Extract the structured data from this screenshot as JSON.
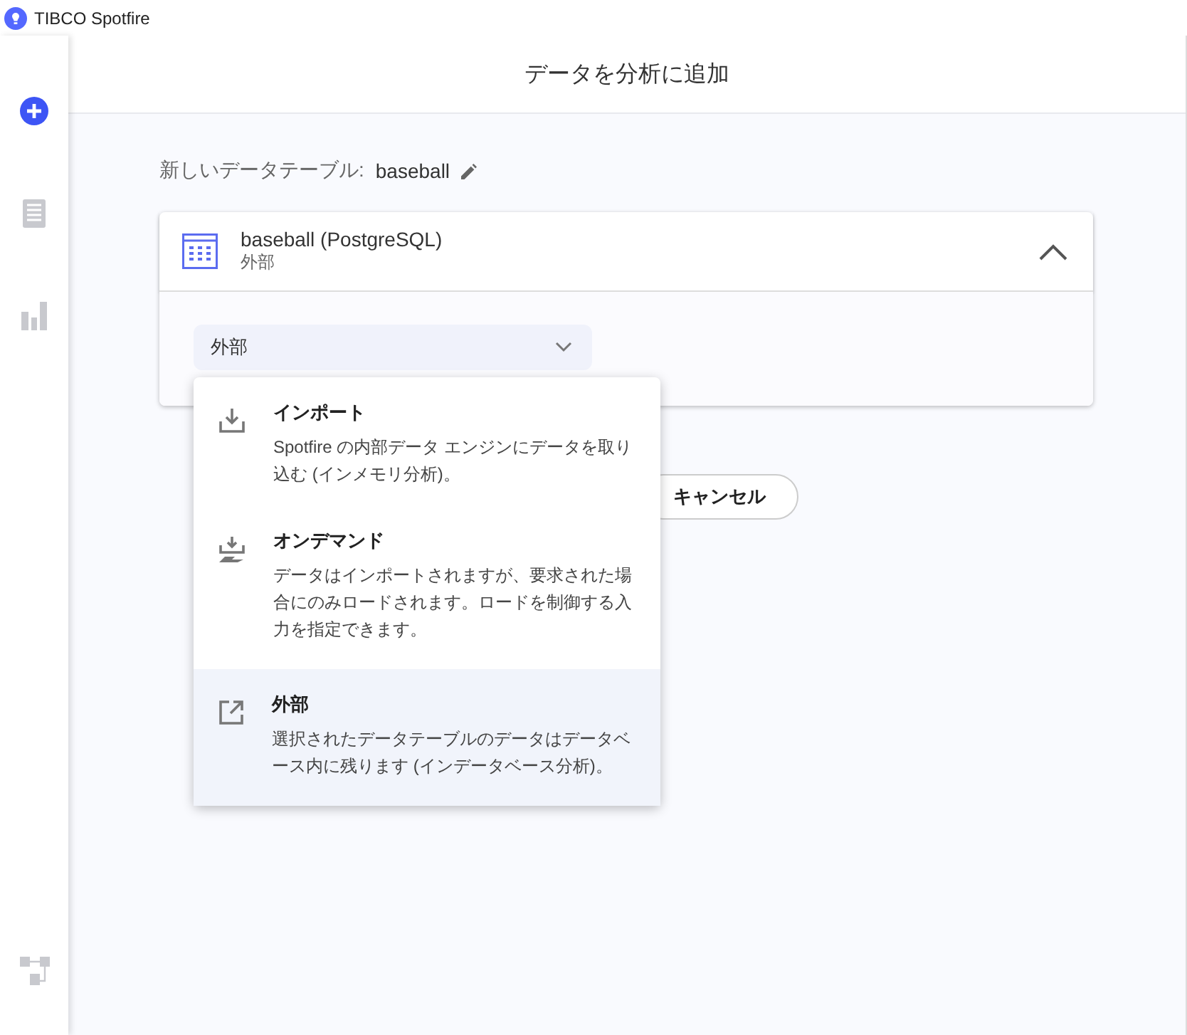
{
  "window": {
    "title": "TIBCO Spotfire"
  },
  "header": {
    "title": "データを分析に追加"
  },
  "table_name": {
    "label": "新しいデータテーブル:",
    "value": "baseball"
  },
  "source_card": {
    "title": "baseball (PostgreSQL)",
    "subtitle": "外部",
    "expanded": true
  },
  "load_method": {
    "value": "外部",
    "expanded": true,
    "options": [
      {
        "kind": "import",
        "title": "インポート",
        "description": "Spotfire の内部データ エンジンにデータを取り込む (インメモリ分析)。",
        "selected": false
      },
      {
        "kind": "ondemand",
        "title": "オンデマンド",
        "description": "データはインポートされますが、要求された場合にのみロードされます。ロードを制御する入力を指定できます。",
        "selected": false
      },
      {
        "kind": "external",
        "title": "外部",
        "description": "選択されたデータテーブルのデータはデータベース内に残ります (インデータベース分析)。",
        "selected": true
      }
    ]
  },
  "buttons": [
    {
      "label": "キャンセル"
    }
  ]
}
